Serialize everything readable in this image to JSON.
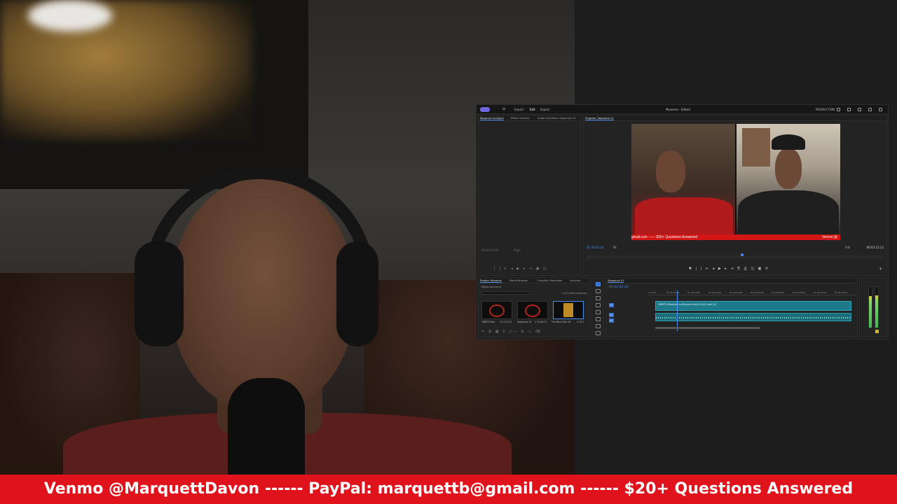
{
  "editor": {
    "menu": {
      "import": "Import",
      "edit": "Edit",
      "export": "Export"
    },
    "window_title": "Mysonne - Edited",
    "workspace": "PRODUCTION",
    "source_tabs": [
      "Mysonne 2v4.4pc2",
      "Effect Controls",
      "Audio Clip Mixer: Sequence 01"
    ],
    "program_tab": "Program: Sequence 01",
    "program": {
      "ticker_text": "gmail.com ------ $20+ Questions Answered",
      "ticker_right": "Venmo @",
      "timecode": "01:42:20:24",
      "fit": "Fit",
      "quality": "Full",
      "duration": "00:02:12:12",
      "controls": "▼ | | ⇤ ◂ ▶ ▸ ⇥ ⎘ ⎙ ◫ ▣ ⟳",
      "add": "+"
    },
    "source": {
      "timecode": "00:00:00:00",
      "page": "Page",
      "controls": "| | ⇤ ◂ ▶ ▸ ⇥ ▣ ◫"
    },
    "project_tabs": [
      "Project: Mysonne",
      "Media Browser",
      "Graphics Templates",
      "Libraries"
    ],
    "project": {
      "path": "Mysonne.prproj",
      "count": "1 of 3 items selected",
      "items": [
        {
          "name": "18IBIT5 Nac",
          "duration": "3:11:11:11"
        },
        {
          "name": "Sequence 01",
          "duration": "2:11:40:17"
        },
        {
          "name": "The Black Bar 16",
          "duration": "2:12:2"
        }
      ],
      "bottom_controls": "✎ ☰ ▦ ⚲ ○— ⇅ ▭ ⌫"
    },
    "timeline": {
      "tab": "Sequence 01",
      "timecode": "01:42:20:24",
      "ruler": [
        "1:15:00",
        "01:42:05:00",
        "01:42:10:00",
        "01:42:15:00",
        "01:42:20:00",
        "01:42:25:00",
        "01:42:30:00",
        "01:42:35:00",
        "01:42:40:00",
        "01:42:45:00"
      ],
      "tracks": [
        "V1",
        "A1",
        "A2"
      ],
      "video_clip": "18IBIT5 (Marquett vs Mysonne Pack2 (Q2)1.mp4 [V]"
    },
    "meters": {
      "left_level": 0.78,
      "right_level": 0.8,
      "solo": "S"
    }
  },
  "ticker": {
    "text": "Venmo @MarquettDavon ------ PayPal: marquettb@gmail.com ------ $20+ Questions Answered",
    "color": "#e0131d"
  },
  "colors": {
    "accent": "#4b8ff0",
    "clip": "#1e7a8a",
    "brand": "#6d66e0"
  }
}
